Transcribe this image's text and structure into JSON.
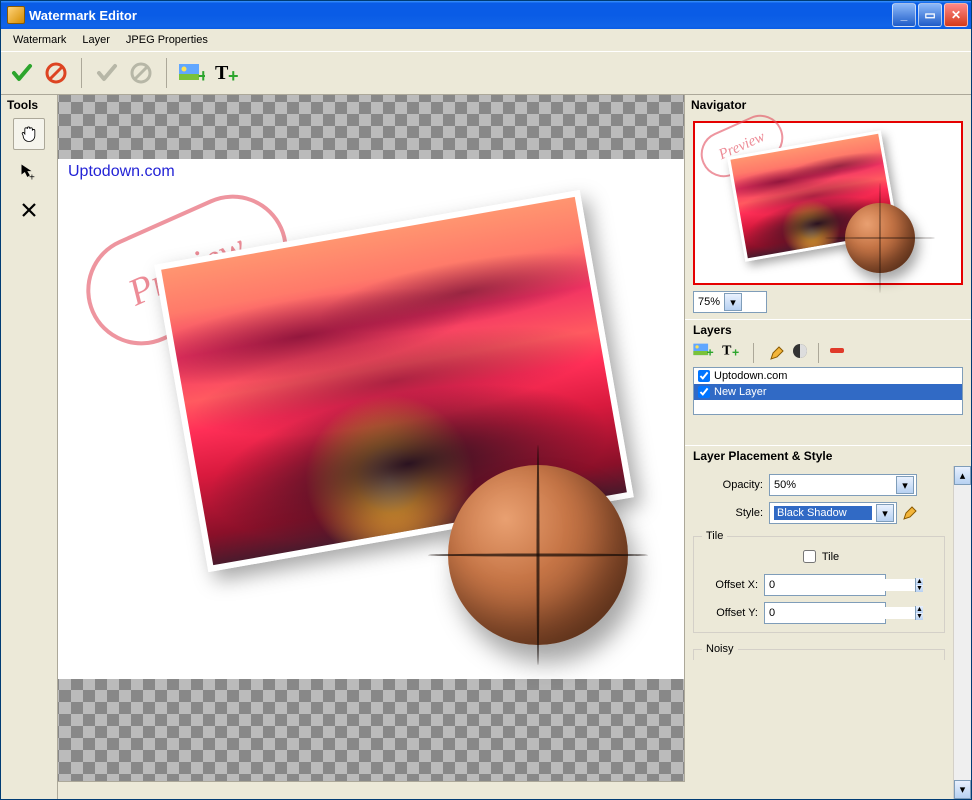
{
  "window": {
    "title": "Watermark Editor"
  },
  "menus": {
    "watermark": "Watermark",
    "layer": "Layer",
    "jpeg": "JPEG Properties"
  },
  "tools": {
    "header": "Tools"
  },
  "canvas": {
    "watermark_text": "Uptodown.com",
    "stamp_text": "Preview"
  },
  "navigator": {
    "header": "Navigator",
    "zoom": "75%"
  },
  "layers": {
    "header": "Layers",
    "items": [
      {
        "label": "Uptodown.com",
        "checked": true,
        "selected": false
      },
      {
        "label": "New Layer",
        "checked": true,
        "selected": true
      }
    ]
  },
  "placement": {
    "header": "Layer Placement & Style",
    "opacity_label": "Opacity:",
    "opacity_value": "50%",
    "style_label": "Style:",
    "style_value": "Black Shadow",
    "tile": {
      "legend": "Tile",
      "checkbox_label": "Tile",
      "offsetx_label": "Offset X:",
      "offsetx_value": "0",
      "offsety_label": "Offset Y:",
      "offsety_value": "0"
    },
    "noisy_legend": "Noisy"
  }
}
